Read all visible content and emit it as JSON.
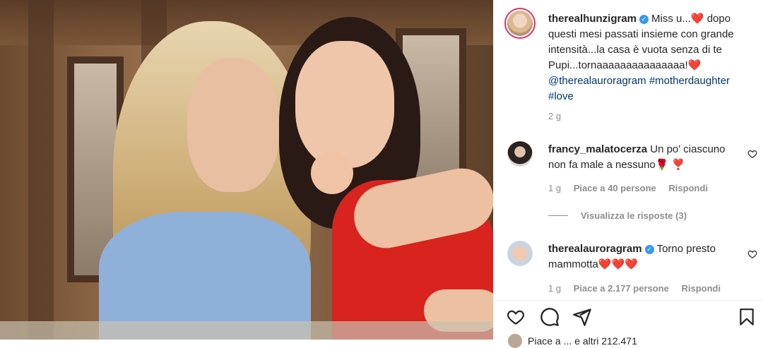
{
  "post": {
    "author": "therealhunzigram",
    "caption_line1": "Miss u...❤️ dopo",
    "caption_line2": "questi mesi passati insieme con grande",
    "caption_line3": "intensità...la casa è vuota senza di te",
    "caption_line4": "Pupi...tornaaaaaaaaaaaaaaa!❤️",
    "mention": "@therealauroragram",
    "hashtag1": "#motherdaughter",
    "hashtag2": "#love",
    "time": "2 g"
  },
  "comments": [
    {
      "user": "francy_malatocerza",
      "text_line1": "Un po' ciascuno",
      "text_line2": "non fa male a nessuno🌹 ❣️",
      "time": "1 g",
      "likes": "Piace a 40 persone",
      "reply": "Rispondi",
      "view_replies": "Visualizza le risposte (3)"
    },
    {
      "user": "therealauroragram",
      "text_line1": "Torno presto",
      "text_line2": "mammotta❤️❤️❤️",
      "time": "1 g",
      "likes": "Piace a 2.177 persone",
      "reply": "Rispondi"
    }
  ],
  "footer": {
    "likes_partial": "Piace a ... e altri 212.471"
  },
  "colors": {
    "link": "#00376b",
    "verified": "#3897f0",
    "muted": "#8e8e8e",
    "story_ring": "#e1306c"
  },
  "icons": [
    "heart-icon",
    "comment-icon",
    "share-icon",
    "bookmark-icon",
    "verified-icon",
    "comment-like-icon"
  ]
}
